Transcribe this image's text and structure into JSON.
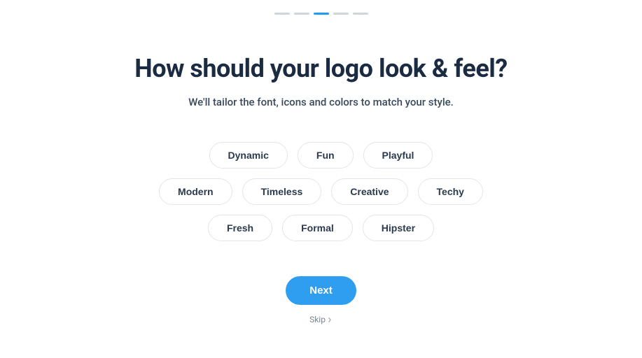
{
  "progress": {
    "total_steps": 5,
    "active_index": 2
  },
  "heading": "How should your logo look & feel?",
  "subheading": "We'll tailor the font, icons and colors to match your style.",
  "style_rows": [
    [
      "Dynamic",
      "Fun",
      "Playful"
    ],
    [
      "Modern",
      "Timeless",
      "Creative",
      "Techy"
    ],
    [
      "Fresh",
      "Formal",
      "Hipster"
    ]
  ],
  "actions": {
    "next_label": "Next",
    "skip_label": "Skip"
  },
  "colors": {
    "accent": "#2f9ef0",
    "text_primary": "#1a2b42",
    "text_secondary": "#3a4a5c",
    "chip_border": "#e2e6eb",
    "progress_inactive": "#d0d5dc"
  }
}
